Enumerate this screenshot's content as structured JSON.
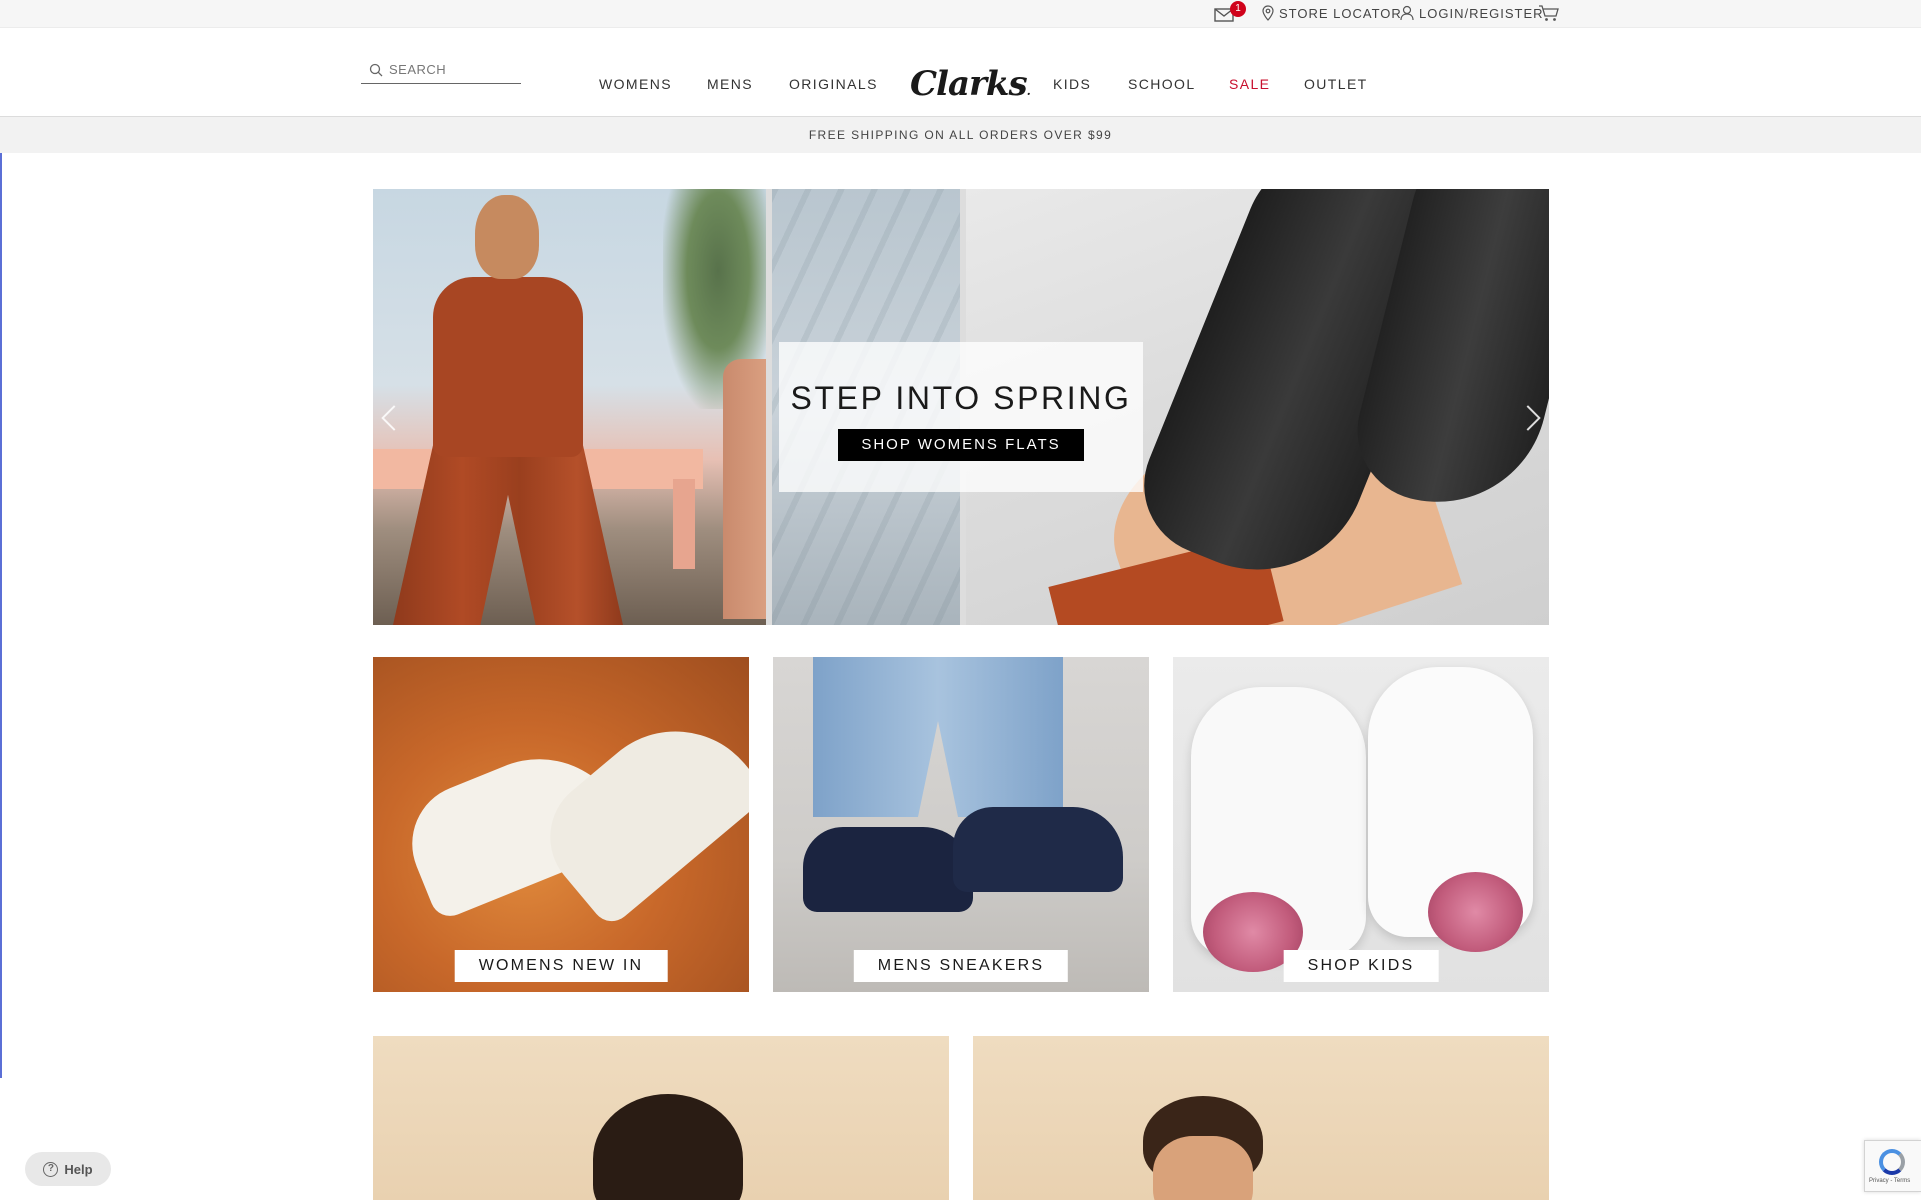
{
  "utility": {
    "mail_badge": "1",
    "store_locator": "STORE LOCATOR",
    "login": "LOGIN/REGISTER"
  },
  "header": {
    "search_placeholder": "SEARCH",
    "logo": "Clarks",
    "nav": {
      "womens": "WOMENS",
      "mens": "MENS",
      "originals": "ORIGINALS",
      "kids": "KIDS",
      "school": "SCHOOL",
      "sale": "SALE",
      "outlet": "OUTLET"
    }
  },
  "promo": "FREE SHIPPING ON ALL ORDERS OVER $99",
  "hero": {
    "title": "STEP INTO SPRING",
    "cta": "SHOP WOMENS FLATS"
  },
  "tiles": [
    {
      "label": "WOMENS NEW IN"
    },
    {
      "label": "MENS SNEAKERS"
    },
    {
      "label": "SHOP KIDS"
    }
  ],
  "help": {
    "label": "Help"
  },
  "recaptcha": {
    "text": "Privacy - Terms"
  },
  "colors": {
    "sale": "#c8102e",
    "badge": "#d0021b",
    "promo_bg": "#f2f2f2",
    "cta_bg": "#000000"
  }
}
